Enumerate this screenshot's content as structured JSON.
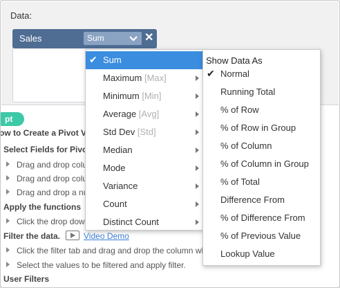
{
  "data_panel": {
    "label": "Data:",
    "field": {
      "name": "Sales",
      "aggregation": "Sum",
      "remove": "✕"
    }
  },
  "help": {
    "tab_label": "pt",
    "title": "ow to Create a Pivot Vi",
    "lines": [
      {
        "text": "Select Fields for Pivot",
        "type": "head"
      },
      {
        "text": "Drag and drop colu",
        "type": "bullet"
      },
      {
        "text": "Drag and drop colu",
        "type": "bullet"
      },
      {
        "text": "Drag and drop a nu",
        "type": "bullet"
      },
      {
        "text": "Apply the functions",
        "type": "head"
      },
      {
        "text": "Click the drop dow",
        "type": "bullet"
      },
      {
        "text": "Filter the data.",
        "type": "head",
        "link": "Video Demo"
      },
      {
        "text": "Click the filter tab and drag and drop the column wh",
        "type": "bullet"
      },
      {
        "text": "Select the values to be filtered and apply filter.",
        "type": "bullet"
      },
      {
        "text": "User Filters",
        "type": "head"
      }
    ]
  },
  "aggregation_menu": {
    "items": [
      {
        "label": "Sum",
        "abbr": "",
        "checked": true,
        "active": true,
        "submenu": true
      },
      {
        "label": "Maximum ",
        "abbr": "[Max]",
        "submenu": true
      },
      {
        "label": "Minimum ",
        "abbr": "[Min]",
        "submenu": true
      },
      {
        "label": "Average ",
        "abbr": "[Avg]",
        "submenu": true
      },
      {
        "label": "Std Dev ",
        "abbr": "[Std]",
        "submenu": true
      },
      {
        "label": "Median",
        "abbr": "",
        "submenu": true
      },
      {
        "label": "Mode",
        "abbr": "",
        "submenu": true
      },
      {
        "label": "Variance",
        "abbr": "",
        "submenu": true
      },
      {
        "label": "Count",
        "abbr": "",
        "submenu": true
      },
      {
        "label": "Distinct Count",
        "abbr": "",
        "submenu": true
      }
    ]
  },
  "show_data_as_menu": {
    "title": "Show Data As",
    "items": [
      {
        "label": "Normal",
        "checked": true
      },
      {
        "label": "Running Total"
      },
      {
        "label": "% of Row"
      },
      {
        "label": "% of Row in Group"
      },
      {
        "label": "% of Column"
      },
      {
        "label": "% of Column in Group"
      },
      {
        "label": "% of Total"
      },
      {
        "label": "Difference From"
      },
      {
        "label": "% of Difference From"
      },
      {
        "label": "% of Previous Value"
      },
      {
        "label": "Lookup Value"
      }
    ]
  },
  "colors": {
    "chip": "#4f6d93",
    "select": "#8ba3c2",
    "menu_active": "#3b8de0",
    "help_tab": "#3cc9a7",
    "link": "#3d7fd6"
  }
}
